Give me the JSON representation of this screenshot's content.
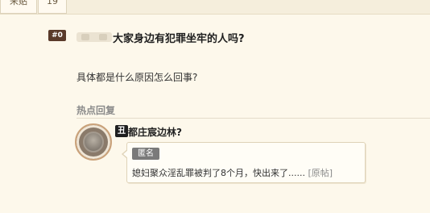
{
  "toolbar": {
    "tab_1": "来贴",
    "tab_2": "19"
  },
  "post": {
    "floor": "#0",
    "title": "大家身边有犯罪坐牢的人吗?",
    "body": "具体都是什么原因怎么回事?"
  },
  "hot_replies": {
    "heading": "热点回复",
    "reply": {
      "level_badge": "丑",
      "author": "都庄宸边林?",
      "anon_tag": "匿名",
      "text": "媳妇聚众淫乱罪被判了8个月，快出来了......",
      "link": "[原帖]"
    }
  },
  "colors": {
    "background": "#fdf8eb",
    "floor_badge": "#5a3a2a",
    "anon_tag": "#7a7a7a"
  }
}
